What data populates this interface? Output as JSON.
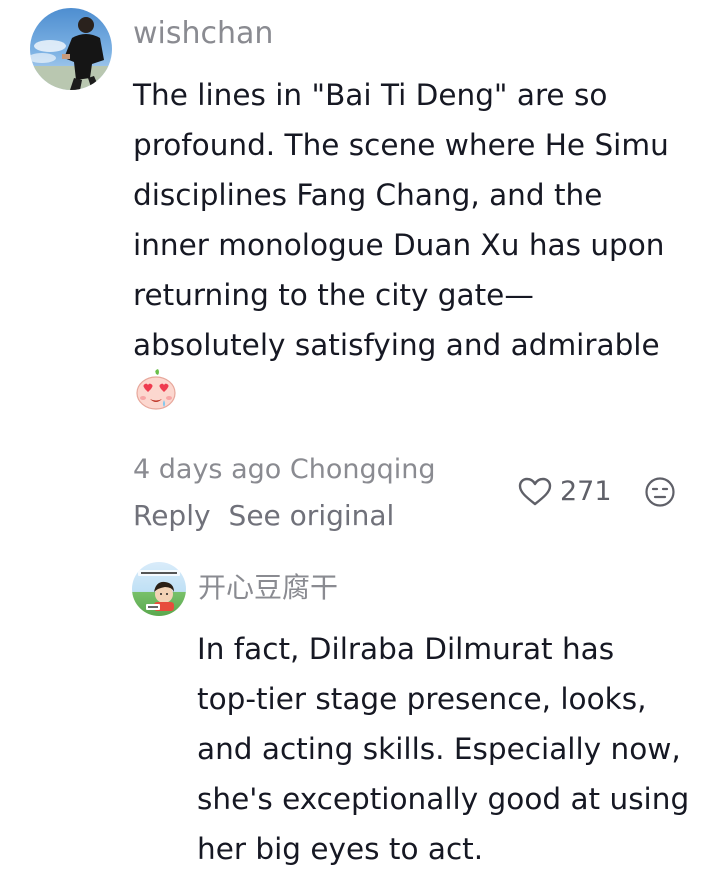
{
  "comment": {
    "username": "wishchan",
    "avatar": "user-avatar-photo",
    "body_lines": [
      "The lines in \"Bai Ti Deng\" are so",
      "profound. The scene where He Simu",
      "disciplines Fang Chang, and the",
      "inner monologue Duan Xu has upon",
      "returning to the city gate—",
      "absolutely satisfying and admirable"
    ],
    "emoji": "heart-eyes-peach-emoji",
    "meta": "4 days ago Chongqing",
    "reply_label": "Reply",
    "see_original_label": "See original",
    "like_count": "271",
    "like_icon": "heart-outline-icon",
    "dislike_icon": "unamused-face-icon"
  },
  "reply": {
    "username": "开心豆腐干",
    "avatar": "cartoon-girl-avatar",
    "body_lines": [
      "In fact, Dilraba Dilmurat has",
      "top-tier stage presence, looks,",
      "and acting skills. Especially now,",
      "she's exceptionally good at using",
      "her big eyes to act."
    ]
  },
  "colors": {
    "text_primary": "#161823",
    "text_secondary": "#8a8b91",
    "action_text": "#70717a",
    "background": "#ffffff"
  }
}
